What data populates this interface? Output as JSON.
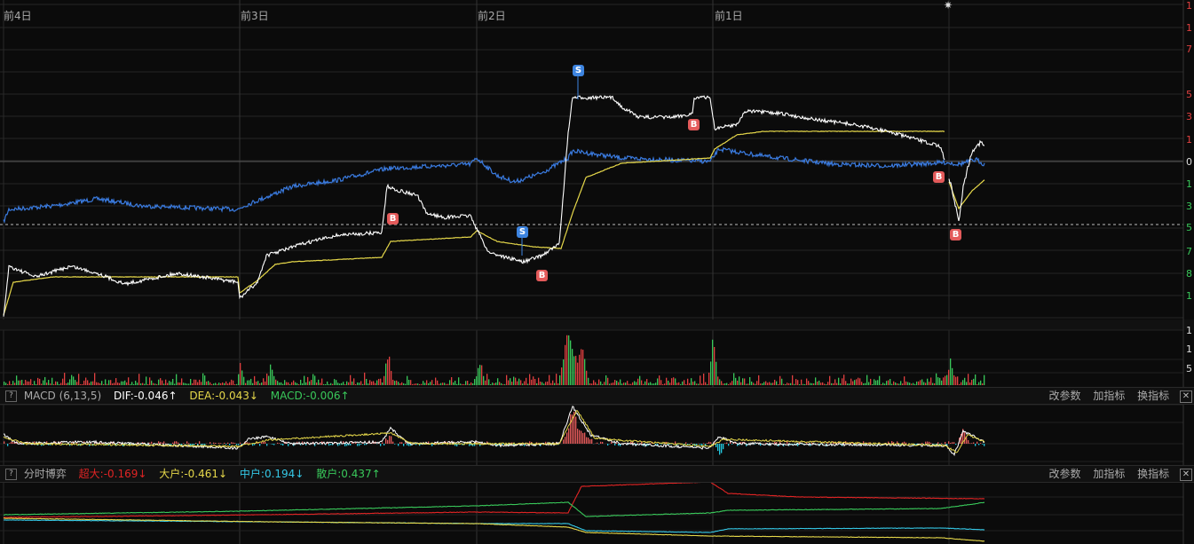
{
  "day_labels": [
    "前4日",
    "前3日",
    "前2日",
    "前1日"
  ],
  "right_axis_main": [
    {
      "text": "1",
      "color": "red"
    },
    {
      "text": "1",
      "color": "red"
    },
    {
      "text": "7",
      "color": "red"
    },
    {
      "text": "5",
      "color": "red"
    },
    {
      "text": "3",
      "color": "red"
    },
    {
      "text": "1",
      "color": "red"
    },
    {
      "text": "0",
      "color": "white"
    },
    {
      "text": "1",
      "color": "green"
    },
    {
      "text": "3",
      "color": "green"
    },
    {
      "text": "5",
      "color": "green"
    },
    {
      "text": "7",
      "color": "green"
    },
    {
      "text": "8",
      "color": "green"
    },
    {
      "text": "1",
      "color": "green"
    }
  ],
  "right_axis_volume": [
    "1",
    "1",
    "5"
  ],
  "trade_markers": [
    {
      "type": "S",
      "label": "S"
    },
    {
      "type": "B",
      "label": "B"
    },
    {
      "type": "S",
      "label": "S"
    },
    {
      "type": "B",
      "label": "B"
    },
    {
      "type": "B",
      "label": "B"
    },
    {
      "type": "B",
      "label": "B"
    },
    {
      "type": "B",
      "label": "B"
    }
  ],
  "macd_panel": {
    "help": "?",
    "title": "MACD (6,13,5)",
    "dif": "DIF:-0.046↑",
    "dea": "DEA:-0.043↓",
    "macd": "MACD:-0.006↑",
    "buttons": [
      "改参数",
      "加指标",
      "换指标"
    ],
    "close": "✕"
  },
  "capital_panel": {
    "help": "?",
    "title": "分时博弈",
    "super_large": "超大:-0.169↓",
    "large": "大户:-0.461↓",
    "medium": "中户:0.194↓",
    "retail": "散户:0.437↑",
    "buttons": [
      "改参数",
      "加指标",
      "换指标"
    ],
    "close": "✕"
  },
  "colors": {
    "price_line": "#ffffff",
    "avg_line": "#e6d84a",
    "index_line": "#3a7be0",
    "up": "#e04040",
    "down": "#39c85a",
    "dif": "#ffffff",
    "dea": "#e6d84a",
    "super_large": "#e02424",
    "large": "#e6d84a",
    "medium": "#35c8e6",
    "retail": "#39c85a"
  }
}
